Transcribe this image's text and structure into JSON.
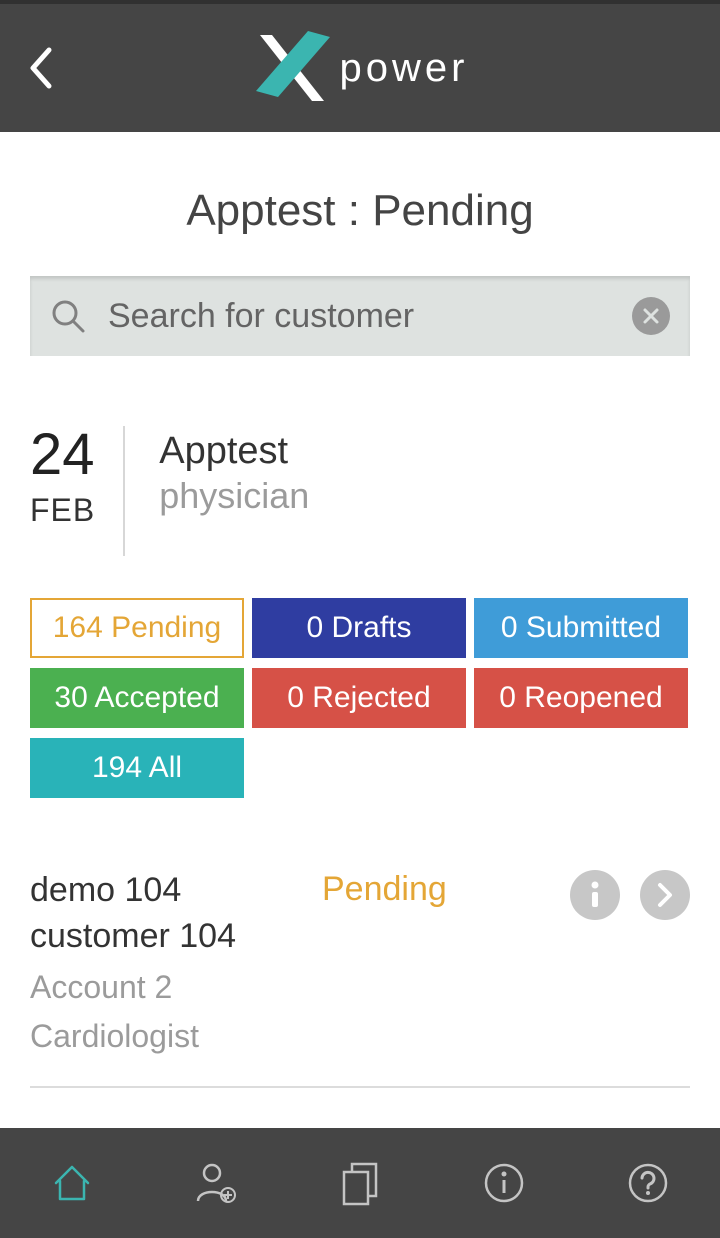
{
  "header": {
    "brand": "power"
  },
  "page": {
    "title": "Apptest : Pending"
  },
  "search": {
    "placeholder": "Search for customer",
    "value": ""
  },
  "record": {
    "day": "24",
    "month": "FEB",
    "name": "Apptest",
    "role": "physician"
  },
  "filters": {
    "pending": {
      "label": "164 Pending"
    },
    "drafts": {
      "label": "0 Drafts"
    },
    "submitted": {
      "label": "0 Submitted"
    },
    "accepted": {
      "label": "30 Accepted"
    },
    "rejected": {
      "label": "0 Rejected"
    },
    "reopened": {
      "label": "0 Reopened"
    },
    "all": {
      "label": "194 All"
    }
  },
  "items": [
    {
      "line1": "demo 104",
      "line2": "customer 104",
      "account": "Account 2",
      "specialty": "Cardiologist",
      "status": "Pending"
    }
  ]
}
